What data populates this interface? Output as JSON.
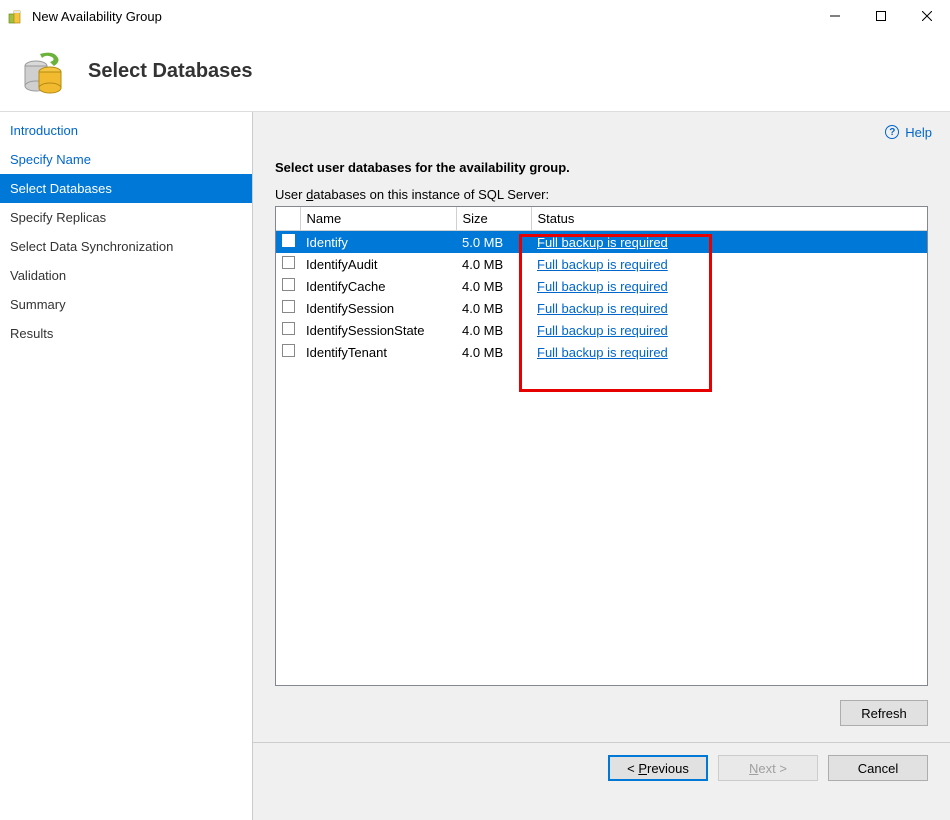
{
  "window": {
    "title": "New Availability Group"
  },
  "header": {
    "title": "Select Databases"
  },
  "help": {
    "label": "Help"
  },
  "sidebar": {
    "items": [
      {
        "label": "Introduction",
        "style": "link"
      },
      {
        "label": "Specify Name",
        "style": "link"
      },
      {
        "label": "Select Databases",
        "style": "selected"
      },
      {
        "label": "Specify Replicas",
        "style": "normal"
      },
      {
        "label": "Select Data Synchronization",
        "style": "normal"
      },
      {
        "label": "Validation",
        "style": "normal"
      },
      {
        "label": "Summary",
        "style": "normal"
      },
      {
        "label": "Results",
        "style": "normal"
      }
    ]
  },
  "main": {
    "instruction": "Select user databases for the availability group.",
    "subtext_prefix": "User ",
    "subtext_ul": "d",
    "subtext_suffix": "atabases on this instance of SQL Server:",
    "columns": {
      "name": "Name",
      "size": "Size",
      "status": "Status"
    },
    "rows": [
      {
        "name": "Identify",
        "size": "5.0 MB",
        "status": "Full backup is required",
        "selected": true
      },
      {
        "name": "IdentifyAudit",
        "size": "4.0 MB",
        "status": "Full backup is required",
        "selected": false
      },
      {
        "name": "IdentifyCache",
        "size": "4.0 MB",
        "status": "Full backup is required",
        "selected": false
      },
      {
        "name": "IdentifySession",
        "size": "4.0 MB",
        "status": "Full backup is required",
        "selected": false
      },
      {
        "name": "IdentifySessionState",
        "size": "4.0 MB",
        "status": "Full backup is required",
        "selected": false
      },
      {
        "name": "IdentifyTenant",
        "size": "4.0 MB",
        "status": "Full backup is required",
        "selected": false
      }
    ],
    "refresh_label": "Refresh"
  },
  "footer": {
    "previous_prefix": "< ",
    "previous_ul": "P",
    "previous_suffix": "revious",
    "next_ul": "N",
    "next_suffix": "ext >",
    "cancel": "Cancel"
  }
}
